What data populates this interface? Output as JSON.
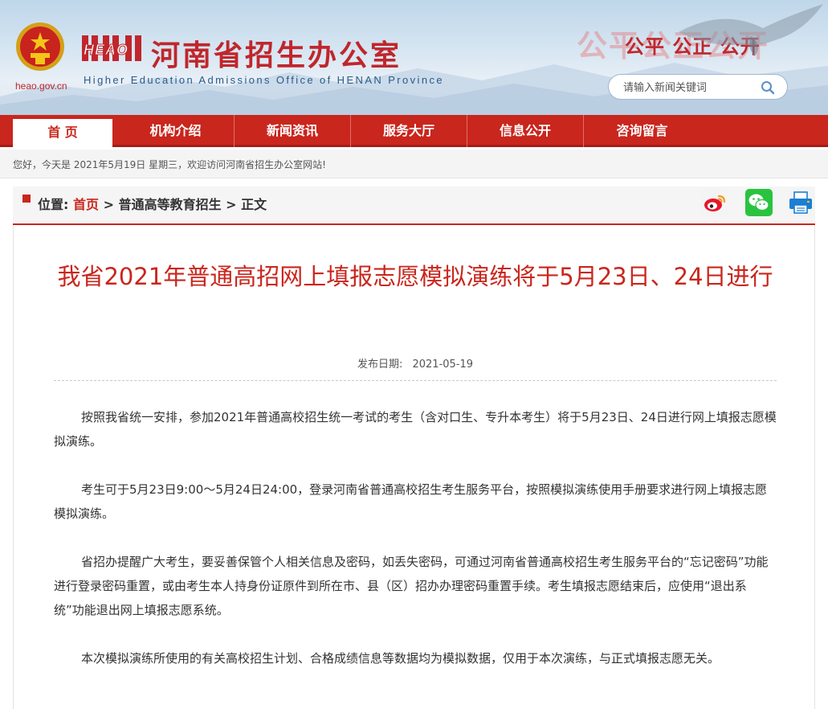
{
  "header": {
    "site_domain": "heao.gov.cn",
    "logo_abbr": "HEAO",
    "title": "河南省招生办公室",
    "subtitle": "Higher Education Admissions Office of HENAN Province",
    "slogan_shadow": "公平公正公开",
    "slogan": "公平 公正 公开",
    "search": {
      "placeholder": "请输入新闻关键词",
      "icon": "search-icon"
    }
  },
  "nav": {
    "items": [
      {
        "label": "首 页",
        "active": true
      },
      {
        "label": "机构介绍"
      },
      {
        "label": "新闻资讯"
      },
      {
        "label": "服务大厅"
      },
      {
        "label": "信息公开"
      },
      {
        "label": "咨询留言"
      }
    ]
  },
  "welcome": "您好，今天是 2021年5月19日 星期三，欢迎访问河南省招生办公室网站!",
  "breadcrumb": {
    "prefix": "位置:",
    "home": "首页",
    "sep": ">",
    "section": "普通高等教育招生",
    "current": "正文"
  },
  "share": [
    "weibo-icon",
    "wechat-icon",
    "print-icon"
  ],
  "colors": {
    "brand_red": "#c9261d",
    "title_red": "#c0262c"
  },
  "article": {
    "title": "我省2021年普通高招网上填报志愿模拟演练将于5月23日、24日进行",
    "pub_label": "发布日期:",
    "pub_date": "2021-05-19",
    "paragraphs": [
      "按照我省统一安排，参加2021年普通高校招生统一考试的考生（含对口生、专升本考生）将于5月23日、24日进行网上填报志愿模拟演练。",
      "考生可于5月23日9:00～5月24日24:00，登录河南省普通高校招生考生服务平台，按照模拟演练使用手册要求进行网上填报志愿模拟演练。",
      "省招办提醒广大考生，要妥善保管个人相关信息及密码，如丢失密码，可通过河南省普通高校招生考生服务平台的“忘记密码”功能进行登录密码重置，或由考生本人持身份证原件到所在市、县（区）招办办理密码重置手续。考生填报志愿结束后，应使用“退出系统”功能退出网上填报志愿系统。",
      "本次模拟演练所使用的有关高校招生计划、合格成绩信息等数据均为模拟数据，仅用于本次演练，与正式填报志愿无关。"
    ]
  }
}
